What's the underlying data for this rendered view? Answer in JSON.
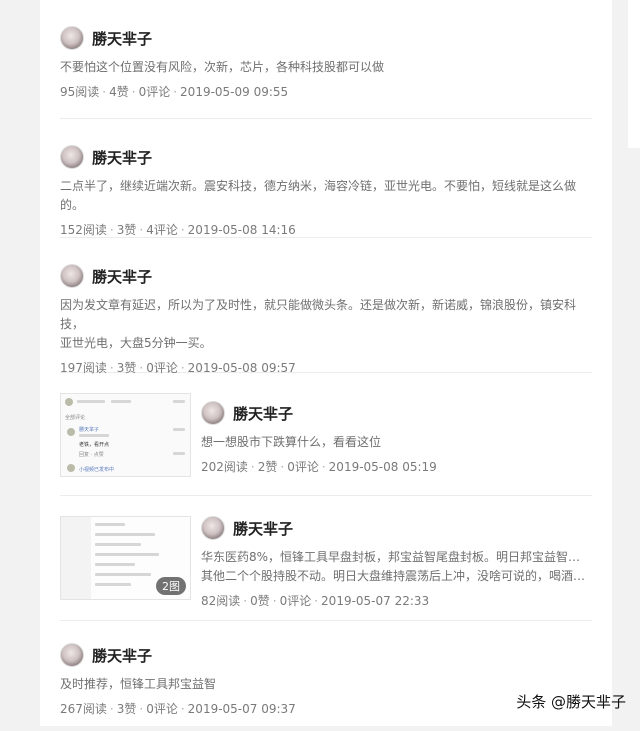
{
  "watermark": "头条 @勝天芈子",
  "posts": [
    {
      "author": "勝天芈子",
      "text": "不要怕这个位置没有风险，次新，芯片，各种科技股都可以做",
      "reads": "95阅读",
      "likes": "4赞",
      "comments": "0评论",
      "time": "2019-05-09 09:55"
    },
    {
      "author": "勝天芈子",
      "text": "二点半了，继续近端次新。震安科技，德方纳米，海容冷链，亚世光电。不要怕，短线就是这么做的。",
      "reads": "152阅读",
      "likes": "3赞",
      "comments": "4评论",
      "time": "2019-05-08 14:16"
    },
    {
      "author": "勝天芈子",
      "text_line1": "因为发文章有延迟，所以为了及时性，就只能做微头条。还是做次新，新诺威，锦浪股份，镇安科技，",
      "text_line2": "亚世光电，大盘5分钟一买。",
      "reads": "197阅读",
      "likes": "3赞",
      "comments": "0评论",
      "time": "2019-05-08 09:57"
    },
    {
      "author": "勝天芈子",
      "text": "想一想股市下跌算什么，看看这位",
      "reads": "202阅读",
      "likes": "2赞",
      "comments": "0评论",
      "time": "2019-05-08 05:19",
      "thumb": {
        "header": "全部评论",
        "commenter": "勝天芈子",
        "comment_line1": "老铁，看开点",
        "comment_line2": "回复 · 点赞",
        "footer": "小视频已发布中"
      }
    },
    {
      "author": "勝天芈子",
      "text_line1": "华东医药8%，恒锋工具早盘封板，邦宝益智尾盘封板。明日邦宝益智高抛，",
      "text_line2": "其他二个个股持股不动。明日大盘维持震荡后上冲，没啥可说的，喝酒去了...",
      "reads": "82阅读",
      "likes": "0赞",
      "comments": "0评论",
      "time": "2019-05-07 22:33",
      "thumb": {
        "badge": "2图"
      }
    },
    {
      "author": "勝天芈子",
      "text": "及时推荐，恒锋工具邦宝益智",
      "reads": "267阅读",
      "likes": "3赞",
      "comments": "0评论",
      "time": "2019-05-07 09:37"
    }
  ]
}
